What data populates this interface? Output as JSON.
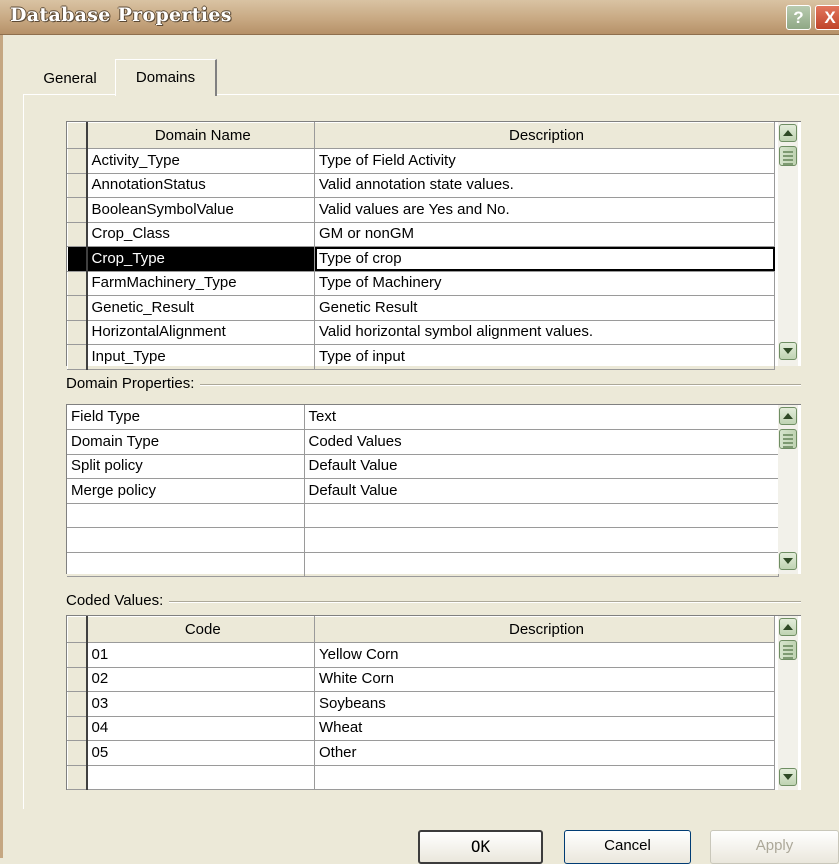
{
  "window": {
    "title": "Database Properties",
    "help_glyph": "?",
    "close_glyph": "X"
  },
  "tabs": [
    {
      "label": "General",
      "active": false
    },
    {
      "label": "Domains",
      "active": true
    }
  ],
  "domains": {
    "columns": [
      "Domain Name",
      "Description"
    ],
    "selected": "Crop_Type",
    "rows": [
      {
        "name": "Activity_Type",
        "description": "Type of Field Activity"
      },
      {
        "name": "AnnotationStatus",
        "description": "Valid annotation state values."
      },
      {
        "name": "BooleanSymbolValue",
        "description": "Valid values are Yes and No."
      },
      {
        "name": "Crop_Class",
        "description": "GM or nonGM"
      },
      {
        "name": "Crop_Type",
        "description": "Type of crop"
      },
      {
        "name": "FarmMachinery_Type",
        "description": "Type of Machinery"
      },
      {
        "name": "Genetic_Result",
        "description": "Genetic Result"
      },
      {
        "name": "HorizontalAlignment",
        "description": "Valid horizontal symbol alignment values."
      },
      {
        "name": "Input_Type",
        "description": "Type of input"
      }
    ]
  },
  "domain_properties": {
    "label": "Domain Properties:",
    "rows": [
      {
        "property": "Field Type",
        "value": "Text"
      },
      {
        "property": "Domain Type",
        "value": "Coded Values"
      },
      {
        "property": "Split policy",
        "value": "Default Value"
      },
      {
        "property": "Merge policy",
        "value": "Default Value"
      },
      {
        "property": "",
        "value": ""
      },
      {
        "property": "",
        "value": ""
      },
      {
        "property": "",
        "value": ""
      }
    ]
  },
  "coded_values": {
    "label": "Coded Values:",
    "columns": [
      "Code",
      "Description"
    ],
    "rows": [
      {
        "code": "01",
        "description": "Yellow Corn"
      },
      {
        "code": "02",
        "description": "White Corn"
      },
      {
        "code": "03",
        "description": "Soybeans"
      },
      {
        "code": "04",
        "description": "Wheat"
      },
      {
        "code": "05",
        "description": "Other"
      },
      {
        "code": "",
        "description": ""
      }
    ]
  },
  "buttons": {
    "ok": "OK",
    "cancel": "Cancel",
    "apply": "Apply"
  }
}
